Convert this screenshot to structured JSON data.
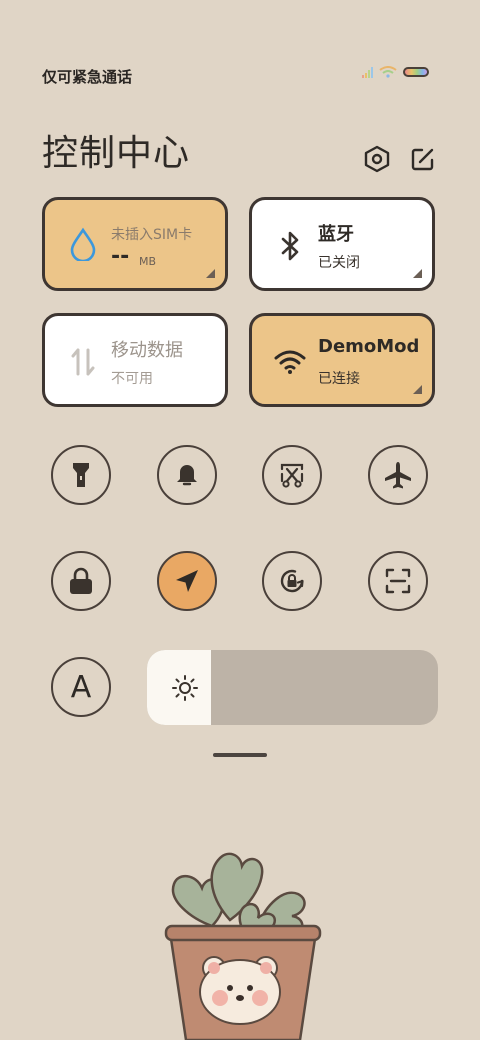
{
  "status_bar": {
    "carrier_text": "仅可紧急通话",
    "signal_icon": "signal-icon",
    "wifi_icon": "wifi-icon",
    "battery_icon": "battery-icon"
  },
  "header": {
    "title": "控制中心",
    "settings_icon": "hexagon-settings-icon",
    "edit_icon": "edit-icon"
  },
  "tiles": [
    {
      "title": "未插入SIM卡",
      "value": "--",
      "unit": "MB",
      "state": "on",
      "icon": "water-drop-icon"
    },
    {
      "title": "蓝牙",
      "sub": "已关闭",
      "state": "off",
      "icon": "bluetooth-icon"
    },
    {
      "title": "移动数据",
      "sub": "不可用",
      "state": "disabled",
      "icon": "data-arrows-icon"
    },
    {
      "title": "DemoMod",
      "sub": "已连接",
      "state": "on",
      "icon": "wifi-icon"
    }
  ],
  "toggles_row1": [
    {
      "icon": "flashlight-icon",
      "active": false
    },
    {
      "icon": "bell-icon",
      "active": false
    },
    {
      "icon": "screenshot-scissors-icon",
      "active": false
    },
    {
      "icon": "airplane-icon",
      "active": false
    }
  ],
  "toggles_row2": [
    {
      "icon": "lock-icon",
      "active": false
    },
    {
      "icon": "location-icon",
      "active": true
    },
    {
      "icon": "rotation-lock-icon",
      "active": false
    },
    {
      "icon": "scan-icon",
      "active": false
    }
  ],
  "auto_brightness": {
    "label": "A"
  },
  "brightness": {
    "level": 0.22,
    "icon": "sun-icon"
  },
  "colors": {
    "background": "#e0d5c6",
    "tile_on": "#ecc589",
    "tile_off": "#ffffff",
    "active_toggle": "#e9a864",
    "slider_track": "#bdb3a7",
    "slider_fill": "#fbf8f2"
  }
}
